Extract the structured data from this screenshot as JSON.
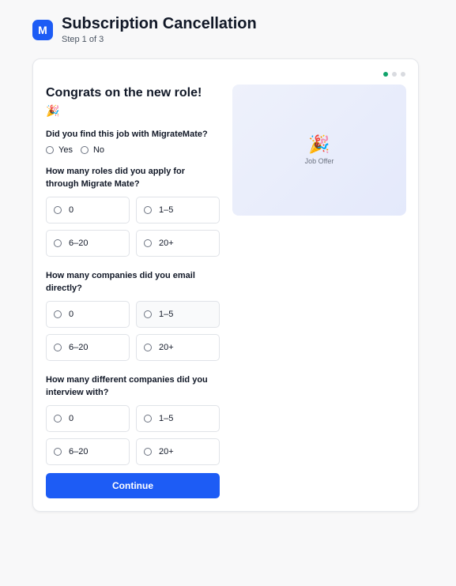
{
  "header": {
    "logo_letter": "M",
    "title": "Subscription Cancellation",
    "step": "Step 1 of 3"
  },
  "progress": {
    "total_steps": 3,
    "current_step": 1
  },
  "colors": {
    "accent": "#1d5cf5",
    "progress_active": "#10a36b"
  },
  "form": {
    "heading": "Congrats on the new role!",
    "heading_emoji": "🎉",
    "q1": {
      "label": "Did you find this job with MigrateMate?",
      "options": [
        "Yes",
        "No"
      ]
    },
    "q2": {
      "label": "How many roles did you apply for through Migrate Mate?",
      "options": [
        "0",
        "1–5",
        "6–20",
        "20+"
      ]
    },
    "q3": {
      "label": "How many companies did you email directly?",
      "options": [
        "0",
        "1–5",
        "6–20",
        "20+"
      ]
    },
    "q4": {
      "label": "How many different companies did you interview with?",
      "options": [
        "0",
        "1–5",
        "6–20",
        "20+"
      ]
    },
    "continue_label": "Continue"
  },
  "image_panel": {
    "emoji": "🎉",
    "label": "Job Offer"
  }
}
